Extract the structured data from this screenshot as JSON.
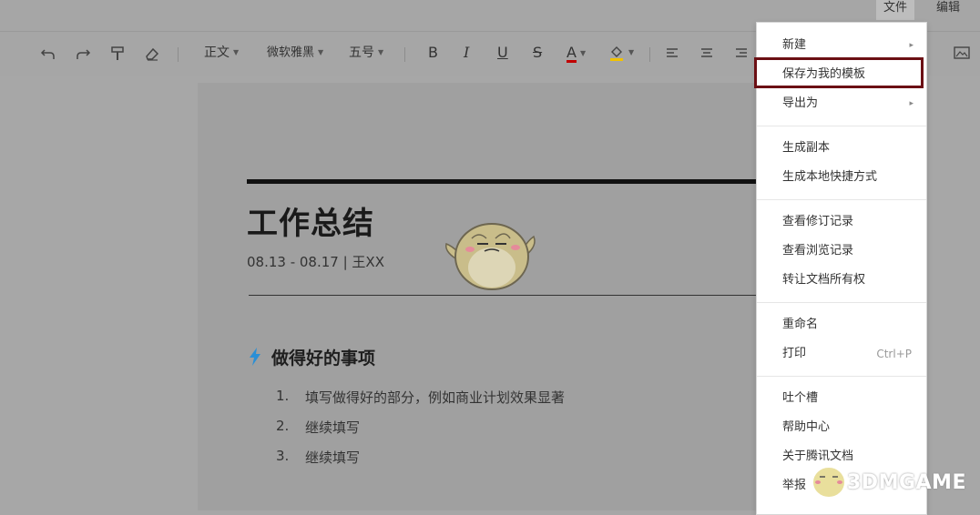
{
  "menubar": {
    "file": "文件",
    "edit": "编辑"
  },
  "toolbar": {
    "style": "正文",
    "font": "微软雅黑",
    "size": "五号",
    "bold": "B",
    "italic": "I",
    "underline": "U",
    "strike": "S",
    "font_color": "A",
    "icons": [
      "undo-icon",
      "redo-icon",
      "format-painter-icon",
      "eraser-icon",
      "fill-color-icon",
      "align-left-icon",
      "align-center-icon",
      "align-right-icon",
      "image-icon"
    ]
  },
  "document": {
    "title": "工作总结",
    "subtitle": "08.13 - 08.17 | 王XX",
    "section_title": "做得好的事项",
    "list": [
      {
        "num": "1.",
        "text": "填写做得好的部分，例如商业计划效果显著"
      },
      {
        "num": "2.",
        "text": "继续填写"
      },
      {
        "num": "3.",
        "text": "继续填写"
      }
    ]
  },
  "file_menu": {
    "items": [
      {
        "label": "新建",
        "arrow": "▸"
      },
      {
        "label": "保存为我的模板"
      },
      {
        "label": "导出为",
        "arrow": "▸"
      },
      {
        "label": "生成副本"
      },
      {
        "label": "生成本地快捷方式"
      },
      {
        "label": "查看修订记录"
      },
      {
        "label": "查看浏览记录"
      },
      {
        "label": "转让文档所有权"
      },
      {
        "label": "重命名"
      },
      {
        "label": "打印",
        "shortcut": "Ctrl+P"
      },
      {
        "label": "吐个槽"
      },
      {
        "label": "帮助中心"
      },
      {
        "label": "关于腾讯文档"
      },
      {
        "label": "举报"
      }
    ]
  },
  "watermark": {
    "text": "3DMGAME"
  },
  "colors": {
    "highlight_border": "#6b0f14",
    "section_icon": "#2a8fd6",
    "font_color_bar": "#c00000",
    "fill_color_bar": "#f2c200"
  }
}
